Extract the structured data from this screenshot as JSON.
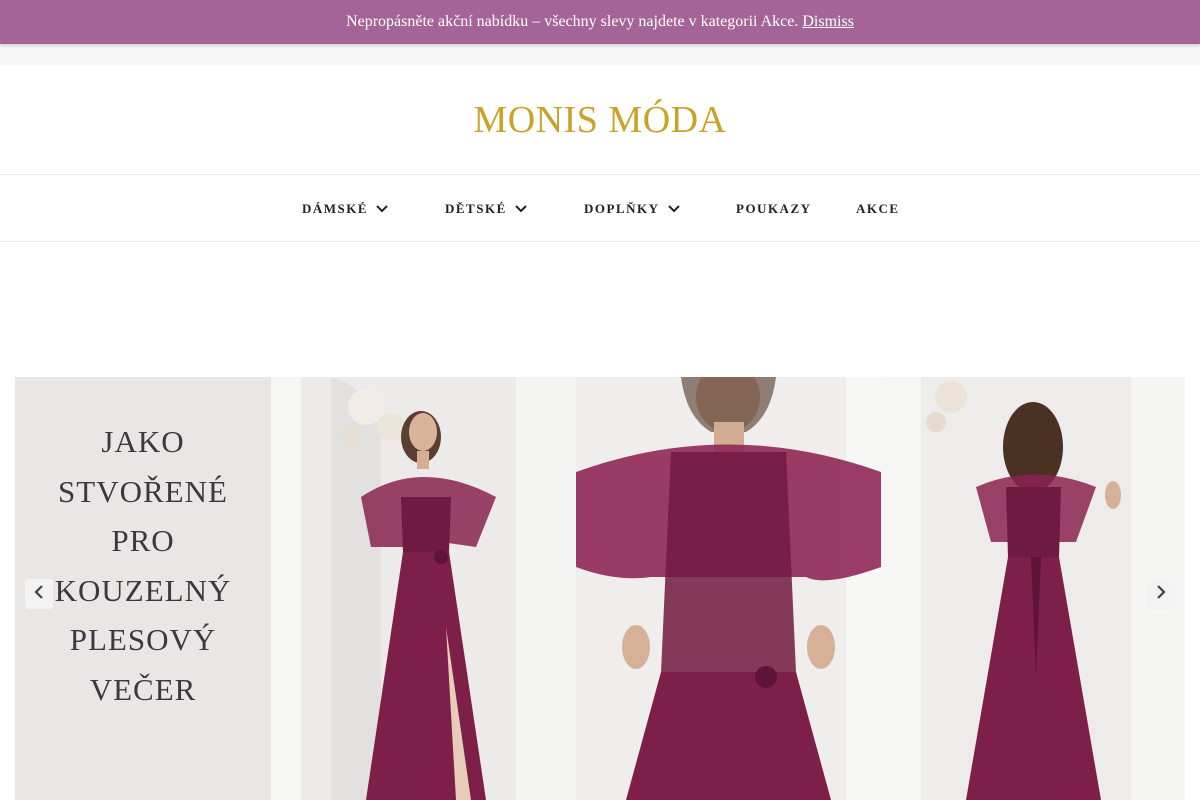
{
  "notice": {
    "text": "Nepropásněte akční nabídku – všechny slevy najdete v kategorii Akce.",
    "dismiss": "Dismiss",
    "bg_color": "#a46497"
  },
  "header": {
    "logo": "MONIS MÓDA",
    "logo_color": "#c9a227"
  },
  "nav": {
    "items": [
      {
        "label": "DÁMSKÉ",
        "has_dropdown": true
      },
      {
        "label": "DĚTSKÉ",
        "has_dropdown": true
      },
      {
        "label": "DOPLŇKY",
        "has_dropdown": true
      },
      {
        "label": "POUKAZY",
        "has_dropdown": false
      },
      {
        "label": "AKCE",
        "has_dropdown": false
      }
    ]
  },
  "slider": {
    "slogan_lines": [
      "JAKO",
      "STVOŘENÉ",
      "PRO",
      "KOUZELNÝ",
      "PLESOVÝ",
      "VEČER"
    ],
    "dress_color": "#7d1f48",
    "prev_icon": "chevron-left-icon",
    "next_icon": "chevron-right-icon"
  }
}
